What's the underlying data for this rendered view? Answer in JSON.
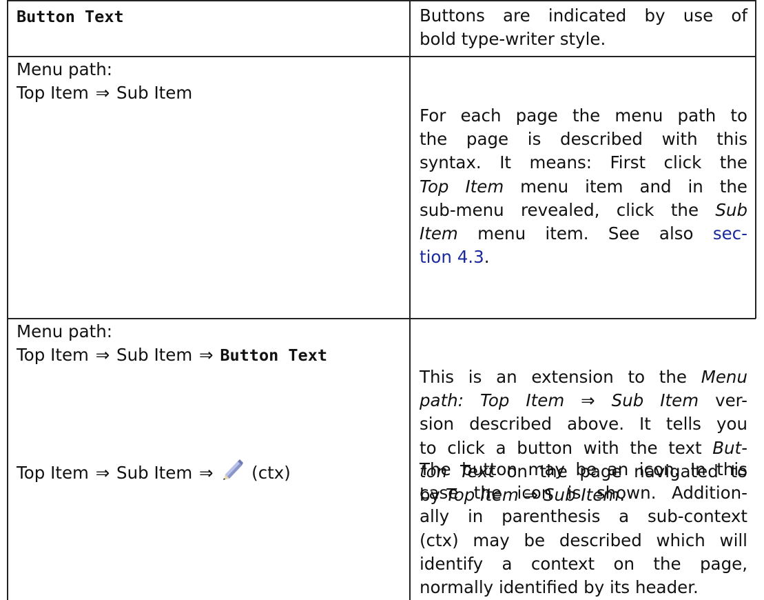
{
  "rows": [
    {
      "left": {
        "button_text": "Button Text"
      },
      "right_lines": [
        "Buttons are indicated by use of",
        "bold type-writer style."
      ]
    },
    {
      "left": {
        "label": "Menu path:",
        "top_item": "Top Item",
        "arrow": "⇒",
        "sub_item": "Sub Item"
      },
      "right": {
        "l1": "For each page the menu path to",
        "l2": "the page is described with this",
        "l3": "syntax. It means: First click the",
        "l4_italic": "Top Item",
        "l4_rest": " menu item and in the",
        "l5_pre": "sub-menu revealed, click the ",
        "l5_italic": "Sub",
        "l6_italic": "Item",
        "l6_mid": " menu item.  See also ",
        "l6_link": "sec-",
        "l7_link": "tion 4.3",
        "l7_rest": "."
      }
    },
    {
      "left": {
        "label": "Menu path:",
        "top_item": "Top Item",
        "arrow": "⇒",
        "sub_item": "Sub Item",
        "button_text": "Button Text"
      },
      "right": {
        "l1_pre": "This is an extension to the ",
        "l1_italic": "Menu",
        "l2_italic": "path: Top Item ⇒ Sub Item",
        "l2_rest": " ver-",
        "l3": "sion described above. It tells you",
        "l4_pre": "to click a button with the text ",
        "l4_italic": "But-",
        "l5_italic": "ton Text",
        "l5_rest": " on the page navigated to",
        "l6_pre": "by ",
        "l6_italic": "Top Item ⇒ Sub Item",
        "l6_rest": "."
      }
    },
    {
      "left": {
        "top_item": "Top Item",
        "arrow": "⇒",
        "sub_item": "Sub Item",
        "icon": "pencil-icon",
        "ctx": "(ctx)"
      },
      "right_lines": [
        "The button may be an icon. In this",
        "case the icon is shown. Addition-",
        "ally in parenthesis a sub-context",
        "(ctx) may be described which will",
        "identify a context on the page,",
        "normally identified by its header."
      ]
    }
  ]
}
